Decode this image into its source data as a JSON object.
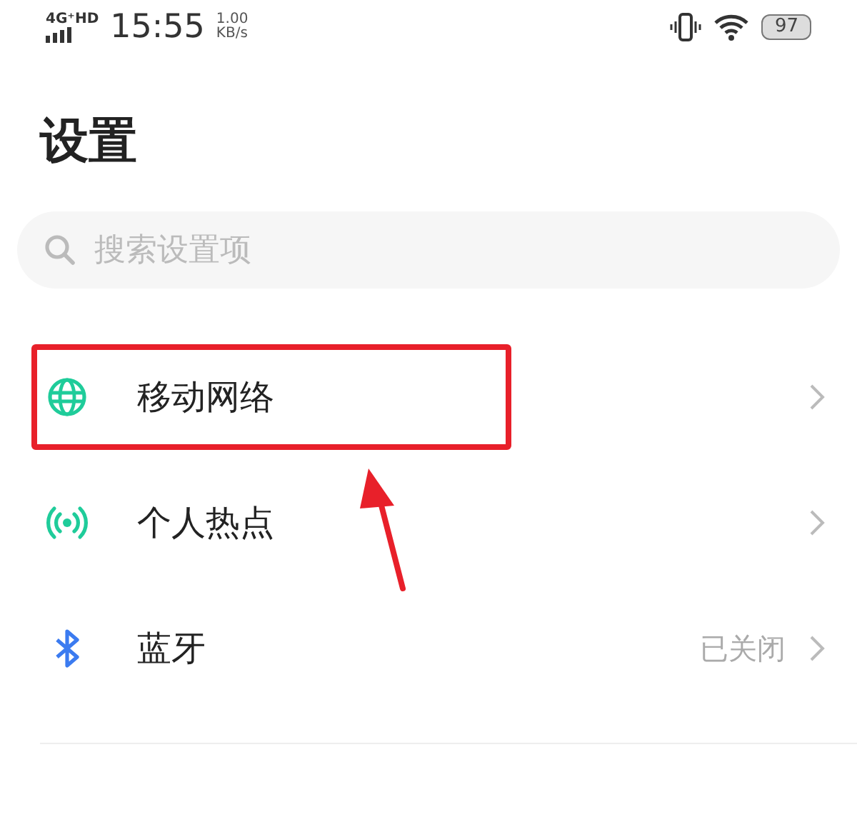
{
  "status_bar": {
    "network": "4G⁺HD",
    "time": "15:55",
    "speed_value": "1.00",
    "speed_unit": "KB/s",
    "battery": "97"
  },
  "title": "设置",
  "search": {
    "placeholder": "搜索设置项"
  },
  "items": [
    {
      "kind": "globe",
      "label": "移动网络",
      "highlighted": true
    },
    {
      "kind": "hotspot",
      "label": "个人热点",
      "highlighted": false
    },
    {
      "kind": "bluetooth",
      "label": "蓝牙",
      "value": "已关闭",
      "highlighted": false
    }
  ],
  "annotation": {
    "arrow": true
  }
}
